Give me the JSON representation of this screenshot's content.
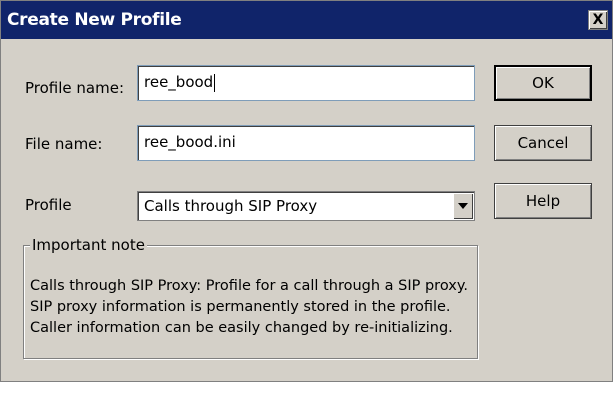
{
  "dialog": {
    "title": "Create New Profile",
    "close_label": "X"
  },
  "form": {
    "profile_name_label": "Profile name:",
    "profile_name_value": "ree_bood",
    "file_name_label": "File name:",
    "file_name_value": "ree_bood.ini",
    "profile_label": "Profile",
    "profile_selected": "Calls through SIP Proxy"
  },
  "buttons": {
    "ok": "OK",
    "cancel": "Cancel",
    "help": "Help"
  },
  "note": {
    "title": "Important note",
    "lines": [
      "Calls through SIP Proxy: Profile for a call through a SIP proxy.",
      "SIP proxy information is permanently stored in the profile.",
      "Caller information can be easily changed by re-initializing."
    ]
  }
}
